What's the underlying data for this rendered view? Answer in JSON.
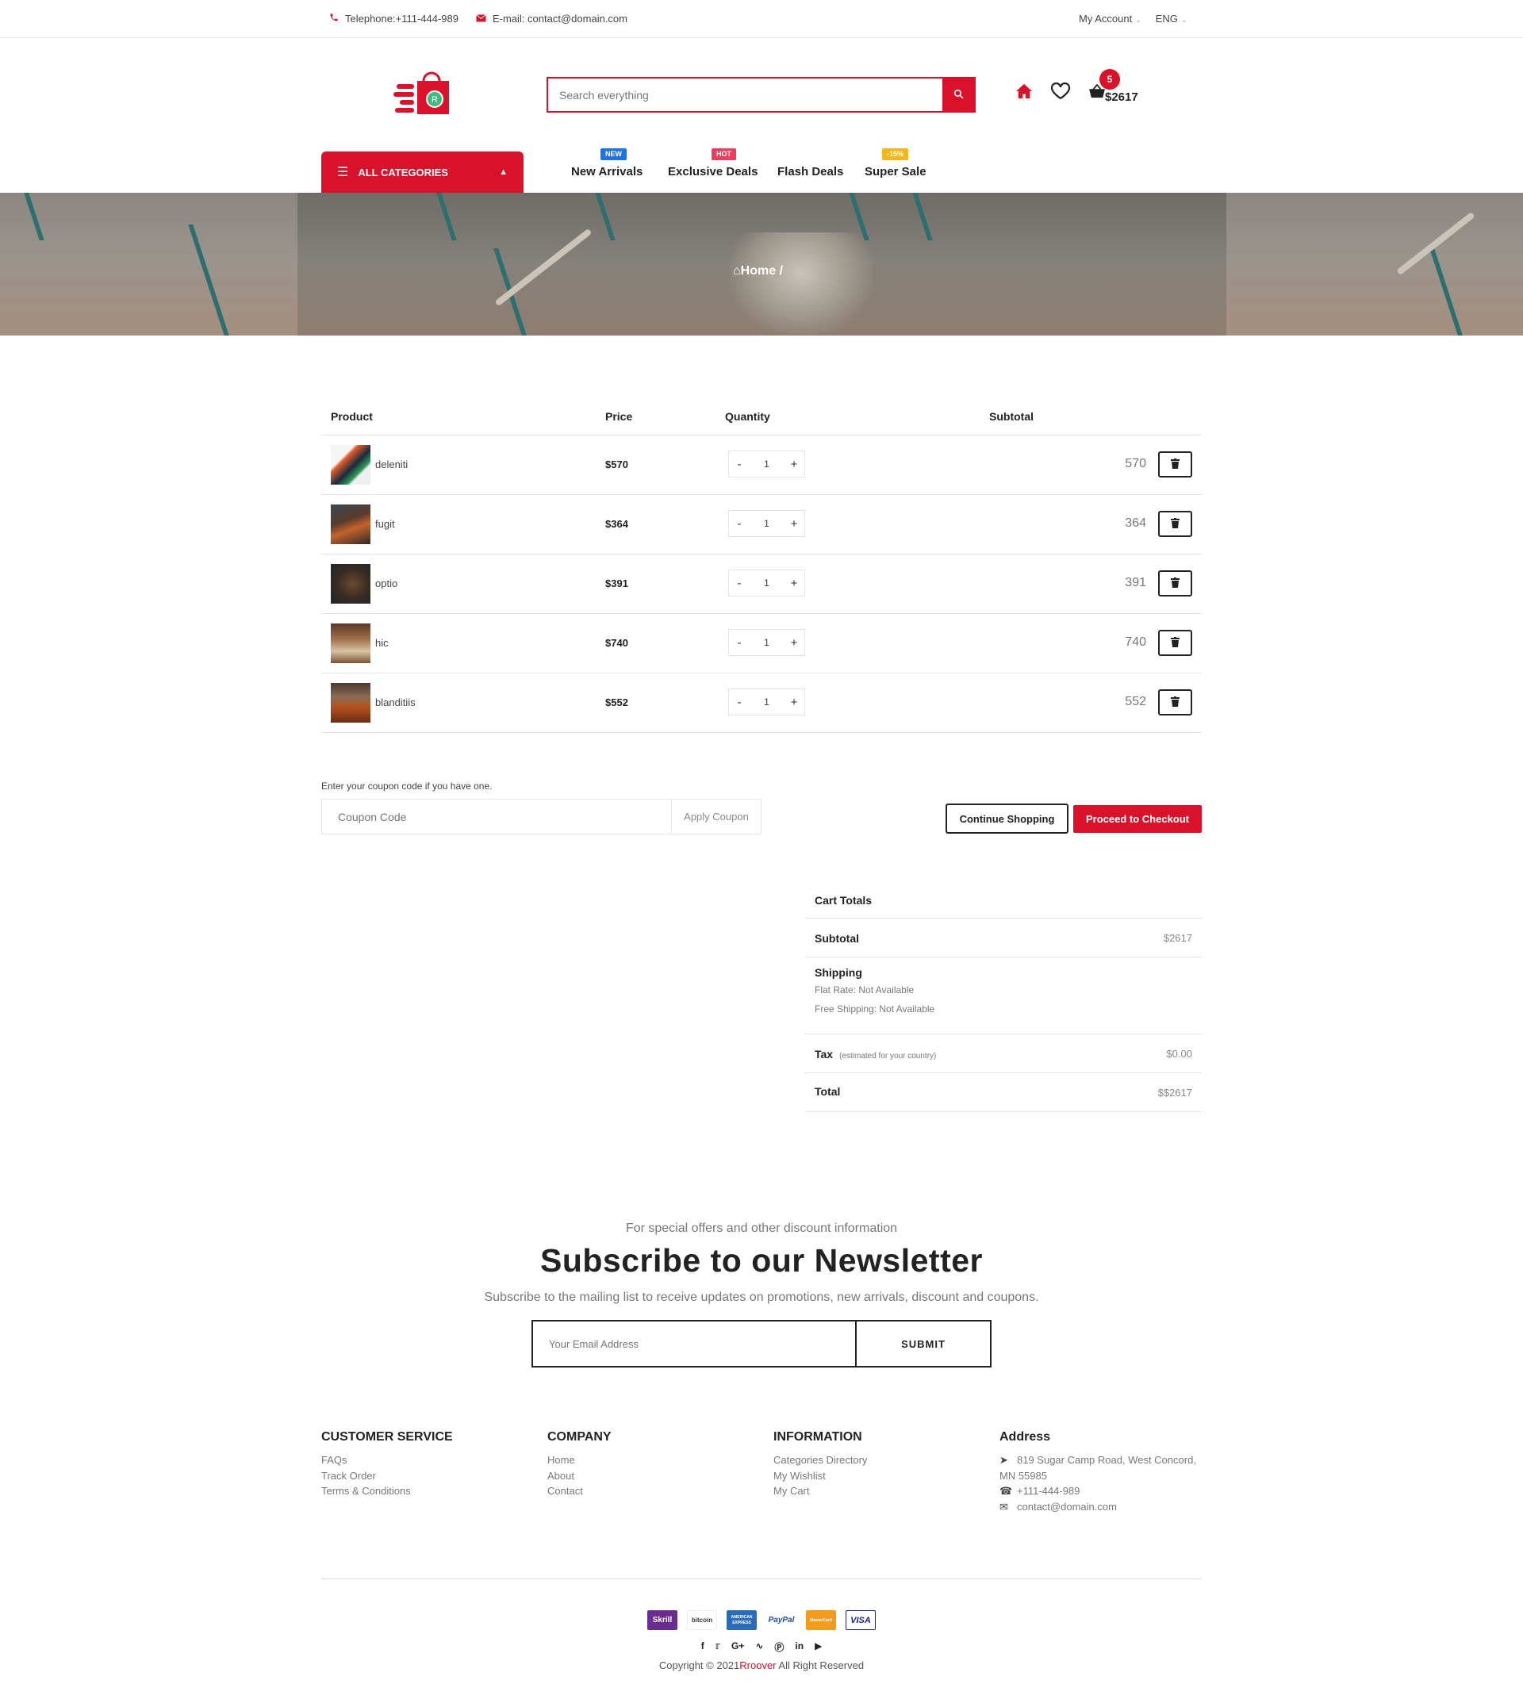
{
  "topbar": {
    "telephone": "Telephone:+111-444-989",
    "email": "E-mail: contact@domain.com",
    "account": "My Account",
    "language": "ENG"
  },
  "header": {
    "search_placeholder": "Search everything",
    "cart_count": "5",
    "cart_total": "$2617"
  },
  "nav": {
    "all_categories": "ALL CATEGORIES",
    "items": [
      {
        "label": "New Arrivals",
        "tag": "NEW",
        "tag_color": "#1a73e8"
      },
      {
        "label": "Exclusive Deals",
        "tag": "HOT",
        "tag_color": "#ef3b5d"
      },
      {
        "label": "Flash Deals",
        "tag": "",
        "tag_color": ""
      },
      {
        "label": "Super Sale",
        "tag": "-15%",
        "tag_color": "#f4b71a"
      }
    ]
  },
  "breadcrumb": {
    "home": "Home /"
  },
  "cart": {
    "headers": {
      "product": "Product",
      "price": "Price",
      "quantity": "Quantity",
      "subtotal": "Subtotal"
    },
    "items": [
      {
        "name": "deleniti",
        "price": "$570",
        "qty": "1",
        "subtotal": "570"
      },
      {
        "name": "fugit",
        "price": "$364",
        "qty": "1",
        "subtotal": "364"
      },
      {
        "name": "optio",
        "price": "$391",
        "qty": "1",
        "subtotal": "391"
      },
      {
        "name": "hic",
        "price": "$740",
        "qty": "1",
        "subtotal": "740"
      },
      {
        "name": "blanditiis",
        "price": "$552",
        "qty": "1",
        "subtotal": "552"
      }
    ],
    "qty_minus": "-",
    "qty_plus": "+"
  },
  "coupon": {
    "label": "Enter your coupon code if you have one.",
    "placeholder": "Coupon Code",
    "apply": "Apply Coupon"
  },
  "actions": {
    "continue": "Continue Shopping",
    "checkout": "Proceed to Checkout"
  },
  "totals": {
    "title": "Cart Totals",
    "subtotal_label": "Subtotal",
    "subtotal_value": "$2617",
    "shipping_label": "Shipping",
    "flat_rate": "Flat Rate: Not Available",
    "free_shipping": "Free Shipping: Not Available",
    "tax_label": "Tax",
    "tax_note": "(estimated for your country)",
    "tax_value": "$0.00",
    "total_label": "Total",
    "total_value": "$$2617"
  },
  "newsletter": {
    "pre": "For special offers and other discount information",
    "title": "Subscribe to our Newsletter",
    "sub": "Subscribe to the mailing list to receive updates on promotions, new arrivals, discount and coupons.",
    "placeholder": "Your Email Address",
    "submit": "SUBMIT"
  },
  "footer": {
    "customer_service": {
      "title": "CUSTOMER SERVICE",
      "links": [
        "FAQs",
        "Track Order",
        "Terms & Conditions"
      ]
    },
    "company": {
      "title": "COMPANY",
      "links": [
        "Home",
        "About",
        "Contact"
      ]
    },
    "information": {
      "title": "INFORMATION",
      "links": [
        "Categories Directory",
        "My Wishlist",
        "My Cart"
      ]
    },
    "address": {
      "title": "Address",
      "street": "819 Sugar Camp Road, West Concord,",
      "city": "MN 55985",
      "phone": "+111-444-989",
      "email": "contact@domain.com"
    },
    "payments": [
      "Skrill",
      "bitcoin",
      "AMERICAN EXPRESS",
      "PayPal",
      "MasterCard",
      "VISA"
    ],
    "social_icons": [
      "facebook-icon",
      "twitter-icon",
      "google-plus-icon",
      "rss-icon",
      "pinterest-icon",
      "linkedin-icon",
      "youtube-icon"
    ],
    "copyright_pre": "Copyright © 2021",
    "copyright_brand": "Rroover",
    "copyright_post": " All Right Reserved"
  },
  "colors": {
    "accent": "#d9112b"
  }
}
